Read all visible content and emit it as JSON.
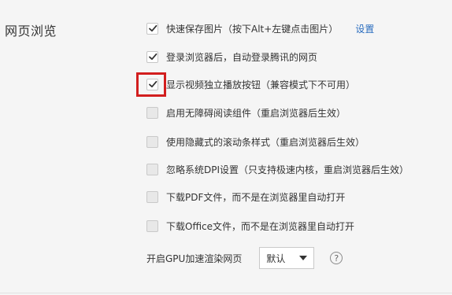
{
  "section": {
    "title": "网页浏览"
  },
  "options": [
    {
      "label": "快速保存图片（按下Alt+左键点击图片）",
      "checked": true,
      "link": "设置"
    },
    {
      "label": "登录浏览器后，自动登录腾讯的网页",
      "checked": true
    },
    {
      "label": "显示视频独立播放按钮（兼容模式下不可用）",
      "checked": true,
      "highlighted": true
    },
    {
      "label": "启用无障碍阅读组件（重启浏览器后生效）",
      "checked": false
    },
    {
      "label": "使用隐藏式的滚动条样式（重启浏览器后生效）",
      "checked": false
    },
    {
      "label": "忽略系统DPI设置（只支持极速内核，重启浏览器后生效）",
      "checked": false
    },
    {
      "label": "下载PDF文件，而不是在浏览器里自动打开",
      "checked": false
    },
    {
      "label": "下载Office文件，而不是在浏览器里自动打开",
      "checked": false
    }
  ],
  "gpu": {
    "label": "开启GPU加速渲染网页",
    "selected": "默认",
    "help_icon": "question-circle-icon",
    "help_glyph": "?"
  },
  "colors": {
    "link": "#2a6dbf",
    "highlight": "#d21e1e",
    "checkmark": "#333333"
  }
}
